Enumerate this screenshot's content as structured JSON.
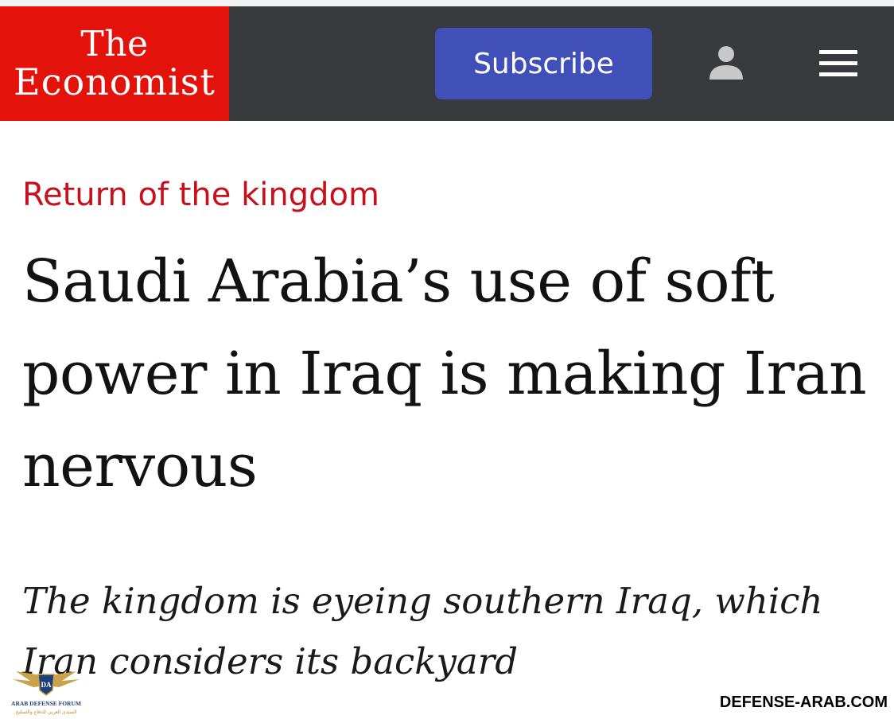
{
  "header": {
    "logo": {
      "line1": "The",
      "line2": "Economist"
    },
    "subscribe_label": "Subscribe",
    "account_icon": "user-icon",
    "menu_icon": "hamburger-menu-icon"
  },
  "article": {
    "kicker": "Return of the kingdom",
    "headline": "Saudi Arabia’s use of soft power in Iraq is making Iran nervous",
    "rubric": "The kingdom is eyeing southern Iraq, which Iran considers its backyard"
  },
  "watermark": {
    "logo_text": "ARAB DEFENSE FORUM",
    "logo_arabic": "المنتدى العربي للدفاع والتسليح",
    "logo_initials": "DA",
    "site": "DEFENSE-ARAB.COM"
  },
  "colors": {
    "brand_red": "#e3120b",
    "header_bg": "#383a3e",
    "subscribe_bg": "#4050b8",
    "kicker": "#c6101c"
  }
}
